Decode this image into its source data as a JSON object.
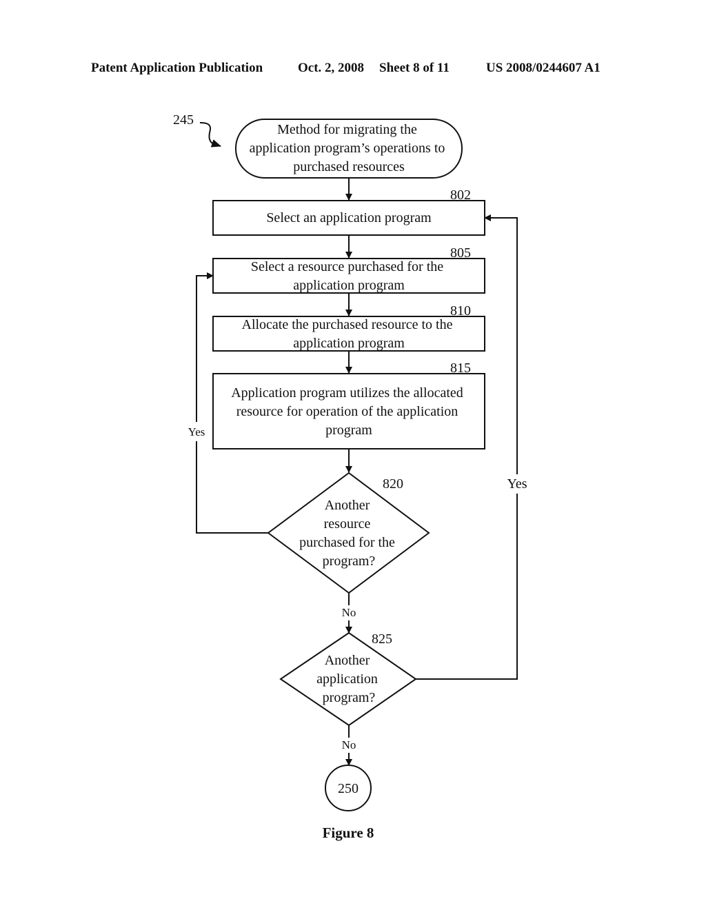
{
  "header": {
    "publication": "Patent Application Publication",
    "date": "Oct. 2, 2008",
    "sheet": "Sheet 8 of 11",
    "number": "US 2008/0244607 A1"
  },
  "diagram": {
    "start": {
      "ref": "245",
      "lines": [
        "Method for migrating the",
        "application program’s operations to",
        "purchased resources"
      ]
    },
    "steps": [
      {
        "ref": "802",
        "lines": [
          "Select an application program"
        ]
      },
      {
        "ref": "805",
        "lines": [
          "Select a resource purchased for the",
          "application program"
        ]
      },
      {
        "ref": "810",
        "lines": [
          "Allocate the purchased resource to the",
          "application program"
        ]
      },
      {
        "ref": "815",
        "lines": [
          "Application program utilizes the allocated",
          "resource for operation of the application",
          "program"
        ]
      }
    ],
    "decisions": [
      {
        "ref": "820",
        "lines": [
          "Another",
          "resource",
          "purchased for the",
          "program?"
        ],
        "yes_label": "Yes",
        "no_label": "No"
      },
      {
        "ref": "825",
        "lines": [
          "Another",
          "application",
          "program?"
        ],
        "yes_label": "Yes",
        "no_label": "No"
      }
    ],
    "end": {
      "label": "250"
    },
    "caption": "Figure 8"
  }
}
